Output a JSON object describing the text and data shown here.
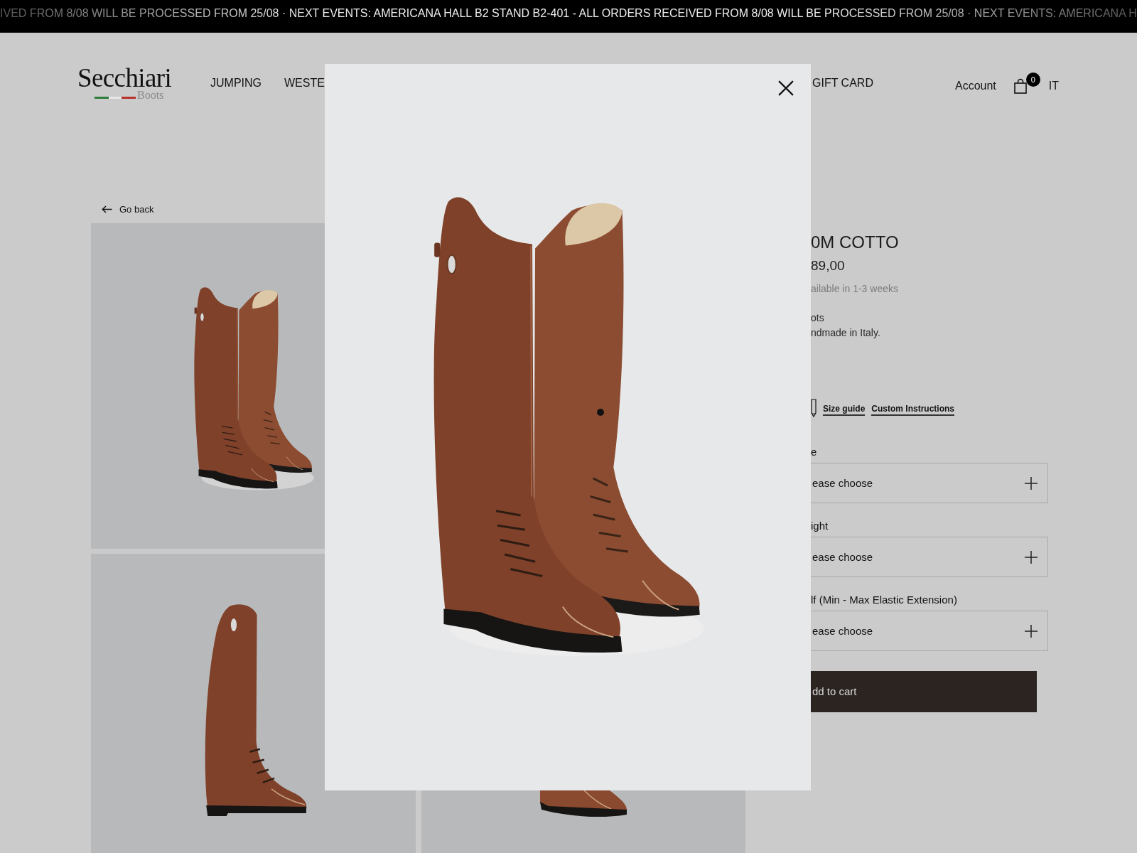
{
  "announcement_bar": {
    "text": "IVED FROM 8/08 WILL BE PROCESSED FROM 25/08 · NEXT EVENTS: AMERICANA HALL B2 STAND B2-401 - ALL ORDERS RECEIVED FROM 8/08 WILL BE PROCESSED FROM 25/08 · NEXT EVENTS: AMERICANA H"
  },
  "header": {
    "logo": {
      "name": "Secchiari",
      "tagline": "Boots"
    },
    "nav_left": [
      "JUMPING",
      "WESTE"
    ],
    "nav_right": [
      "GIFT CARD"
    ],
    "account": "Account",
    "cart_count": "0",
    "language": "IT"
  },
  "back_link": "Go back",
  "product": {
    "title": "0M COTTO",
    "price": "89,00",
    "availability": "ailable in 1-3 weeks",
    "description": [
      "ots",
      "ndmade in Italy."
    ],
    "links": [
      "Size guide",
      "Custom Instructions"
    ],
    "options": [
      {
        "label": "e",
        "value": "ease choose"
      },
      {
        "label": "ight",
        "value": "ease choose"
      },
      {
        "label": "lf (Min - Max Elastic Extension)",
        "value": "ease choose"
      }
    ],
    "add_to_cart": "dd to cart"
  }
}
